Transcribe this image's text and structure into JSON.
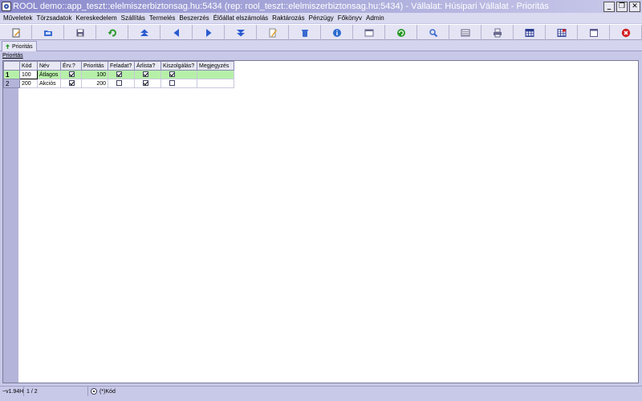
{
  "window": {
    "title": "ROOL demo::app_teszt::elelmiszerbiztonsag.hu:5434 (rep: rool_teszt::elelmiszerbiztonsag.hu:5434) - Vállalat: Húsipari Vállalat - Prioritás",
    "minimize_label": "_",
    "restore_label": "❐",
    "close_label": "✕"
  },
  "menu": [
    "Műveletek",
    "Törzsadatok",
    "Kereskedelem",
    "Szállítás",
    "Termelés",
    "Beszerzés",
    "Élőállat elszámolás",
    "Raktározás",
    "Pénzügy",
    "Főkönyv",
    "Admin"
  ],
  "toolbar": {
    "buttons": [
      {
        "icon": "edit-doc-icon",
        "color": "#d88a1a"
      },
      {
        "icon": "open-folder-icon",
        "color": "#3a6ad0"
      },
      {
        "icon": "save-disk-icon",
        "color": "#5a5a80"
      },
      {
        "icon": "undo-icon",
        "color": "#2a9a2a"
      },
      {
        "icon": "first-record-icon",
        "color": "#2a5ad0"
      },
      {
        "icon": "previous-record-icon",
        "color": "#2a5ad0"
      },
      {
        "icon": "next-record-icon",
        "color": "#2a5ad0"
      },
      {
        "icon": "last-record-icon",
        "color": "#2a5ad0"
      },
      {
        "icon": "pencil-icon",
        "color": "#e0a020"
      },
      {
        "icon": "delete-bin-icon",
        "color": "#3a6ad0"
      },
      {
        "icon": "info-icon",
        "color": "#2a6ad0"
      },
      {
        "icon": "form-view-icon",
        "color": "#6a6a90"
      },
      {
        "icon": "refresh-icon",
        "color": "#2a9a2a"
      },
      {
        "icon": "search-icon",
        "color": "#3a6ad0"
      },
      {
        "icon": "list-view-icon",
        "color": "#5a5a80"
      },
      {
        "icon": "print-icon",
        "color": "#6a6a90"
      },
      {
        "icon": "table-view-icon",
        "color": "#2a3a90"
      },
      {
        "icon": "table-edit-icon",
        "color": "#2a3a90"
      },
      {
        "icon": "window-icon",
        "color": "#5a5a90"
      },
      {
        "icon": "close-circle-icon",
        "color": "#d02020"
      }
    ]
  },
  "tab": {
    "label": "Prioritás",
    "icon": "tree-icon",
    "icon_color": "#2a9a2a"
  },
  "section_label": "Prioritás",
  "table": {
    "columns": [
      "Kód",
      "Név",
      "Érv.?",
      "Prioritás",
      "Feladat?",
      "Árlista?",
      "Kiszolgálás?",
      "Megjegyzés"
    ],
    "rows": [
      {
        "row_no": "1",
        "kod": "100",
        "nev": "Átlagos",
        "erv": true,
        "prioritas": "100",
        "feladat": true,
        "arlista": true,
        "kiszolgalas": true,
        "megjegyzes": ""
      },
      {
        "row_no": "2",
        "kod": "200",
        "nev": "Akciós",
        "erv": true,
        "prioritas": "200",
        "feladat": false,
        "arlista": true,
        "kiszolgalas": false,
        "megjegyzes": ""
      }
    ],
    "selected_row_color": "#b6f0a8"
  },
  "status": {
    "version": "~v1.94H",
    "position": "1 / 2",
    "sort_label": "(*)Kód"
  }
}
